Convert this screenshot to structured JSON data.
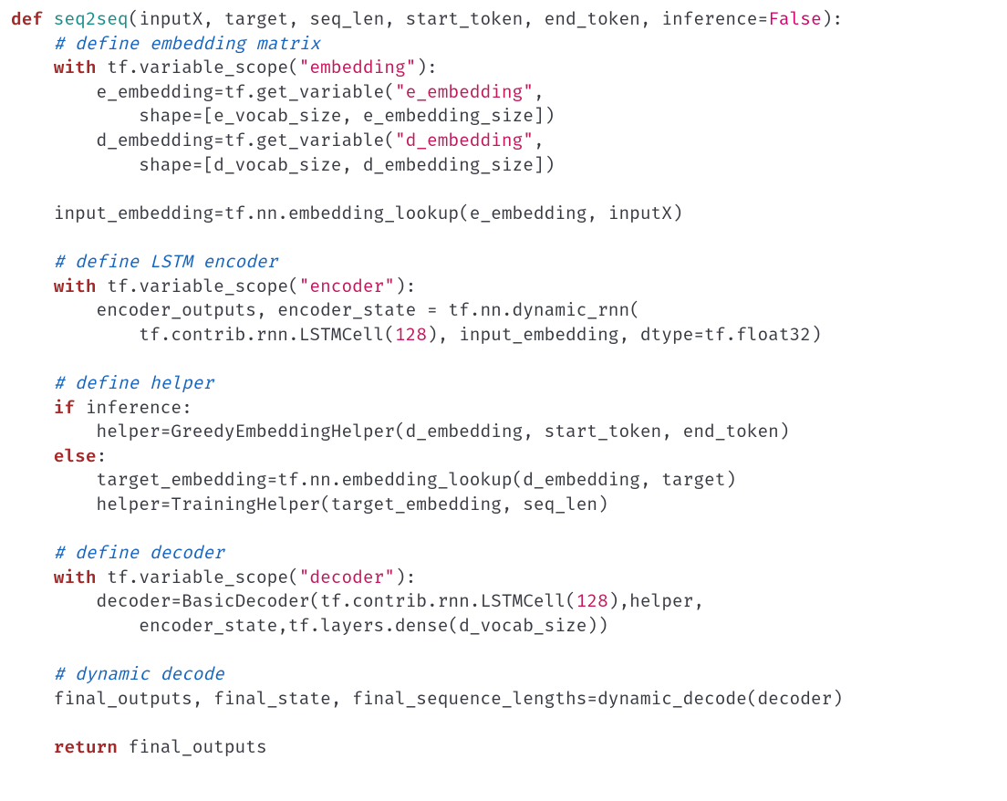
{
  "colors": {
    "keyword": "#a42828",
    "function": "#148f8a",
    "string": "#c2185b",
    "comment": "#1565c0",
    "number": "#c2185b",
    "boolean": "#d6006c",
    "text": "#383a42"
  },
  "code": {
    "l01": {
      "kw": "def",
      "fn": "seq2seq",
      "params": "(inputX, target, seq_len, start_token, end_token, inference=",
      "bool": "False",
      "paren": "):"
    },
    "l02": {
      "cmt": "# define embedding matrix"
    },
    "l03": {
      "kw": "with",
      "a": " tf.variable_scope(",
      "s": "\"embedding\"",
      "b": "):"
    },
    "l04": {
      "a": "        e_embedding=tf.get_variable(",
      "s": "\"e_embedding\"",
      "b": ","
    },
    "l05": {
      "a": "            shape=[e_vocab_size, e_embedding_size])"
    },
    "l06": {
      "a": "        d_embedding=tf.get_variable(",
      "s": "\"d_embedding\"",
      "b": ","
    },
    "l07": {
      "a": "            shape=[d_vocab_size, d_embedding_size])"
    },
    "l08": {
      "a": ""
    },
    "l09": {
      "a": "    input_embedding=tf.nn.embedding_lookup(e_embedding, inputX)"
    },
    "l10": {
      "a": ""
    },
    "l11": {
      "cmt": "# define LSTM encoder"
    },
    "l12": {
      "kw": "with",
      "a": " tf.variable_scope(",
      "s": "\"encoder\"",
      "b": "):"
    },
    "l13": {
      "a": "        encoder_outputs, encoder_state = tf.nn.dynamic_rnn("
    },
    "l14": {
      "a": "            tf.contrib.rnn.LSTMCell(",
      "n": "128",
      "b": "), input_embedding, dtype=tf.float32)"
    },
    "l15": {
      "a": ""
    },
    "l16": {
      "cmt": "# define helper"
    },
    "l17": {
      "kw": "if",
      "a": " inference:"
    },
    "l18": {
      "a": "        helper=GreedyEmbeddingHelper(d_embedding, start_token, end_token)"
    },
    "l19": {
      "kw": "else",
      "a": ":"
    },
    "l20": {
      "a": "        target_embedding=tf.nn.embedding_lookup(d_embedding, target)"
    },
    "l21": {
      "a": "        helper=TrainingHelper(target_embedding, seq_len)"
    },
    "l22": {
      "a": ""
    },
    "l23": {
      "cmt": "# define decoder"
    },
    "l24": {
      "kw": "with",
      "a": " tf.variable_scope(",
      "s": "\"decoder\"",
      "b": "):"
    },
    "l25": {
      "a": "        decoder=BasicDecoder(tf.contrib.rnn.LSTMCell(",
      "n": "128",
      "b": "),helper,"
    },
    "l26": {
      "a": "            encoder_state,tf.layers.dense(d_vocab_size))"
    },
    "l27": {
      "a": ""
    },
    "l28": {
      "cmt": "# dynamic decode"
    },
    "l29": {
      "a": "    final_outputs, final_state, final_sequence_lengths=dynamic_decode(decoder)"
    },
    "l30": {
      "a": ""
    },
    "l31": {
      "kw": "return",
      "a": " final_outputs"
    }
  }
}
